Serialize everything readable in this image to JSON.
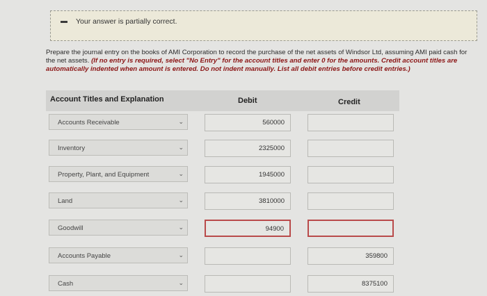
{
  "banner": {
    "message": "Your answer is partially correct.",
    "icon": "minus-icon"
  },
  "prompt": {
    "text": "Prepare the journal entry on the books of AMI Corporation to record the purchase of the net assets of Windsor Ltd, assuming AMI paid cash for the net assets.",
    "instructions": "(If no entry is required, select \"No Entry\" for the account titles and enter 0 for the amounts. Credit account titles are automatically indented when amount is entered. Do not indent manually. List all debit entries before credit entries.)"
  },
  "table": {
    "headers": {
      "account": "Account Titles and Explanation",
      "debit": "Debit",
      "credit": "Credit"
    },
    "rows": [
      {
        "account": "Accounts Receivable",
        "debit": "560000",
        "credit": ""
      },
      {
        "account": "Inventory",
        "debit": "2325000",
        "credit": ""
      },
      {
        "account": "Property, Plant, and Equipment",
        "debit": "1945000",
        "credit": ""
      },
      {
        "account": "Land",
        "debit": "3810000",
        "credit": ""
      },
      {
        "account": "Goodwill",
        "debit": "94900",
        "credit": ""
      },
      {
        "account": "Accounts Payable",
        "debit": "",
        "credit": "359800"
      },
      {
        "account": "Cash",
        "debit": "",
        "credit": "8375100"
      }
    ]
  },
  "colors": {
    "error_border": "#b94a4a",
    "instruction_text": "#8b1515"
  }
}
